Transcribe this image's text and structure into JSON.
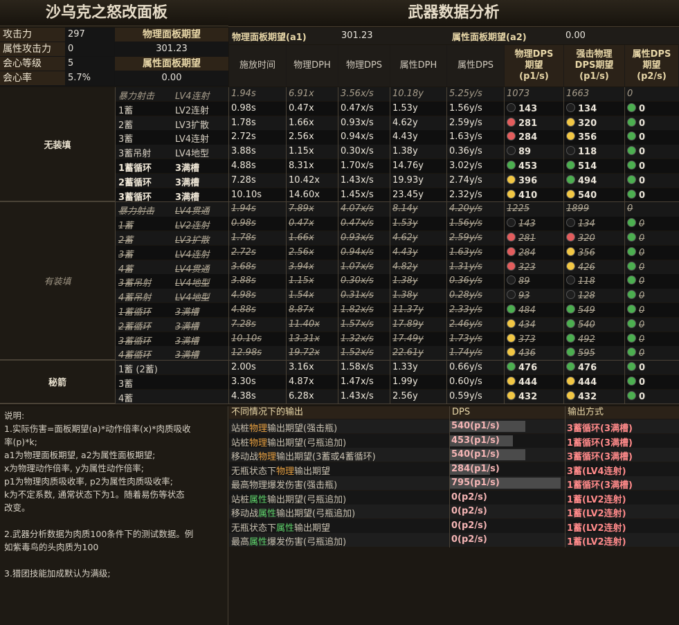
{
  "left_title": "沙乌克之怒改面板",
  "right_title": "武器数据分析",
  "stats": [
    {
      "label": "攻击力",
      "value": "297",
      "right": "物理面板期望"
    },
    {
      "label": "属性攻击力",
      "value": "0",
      "right": "301.23"
    },
    {
      "label": "会心等级",
      "value": "5",
      "right": "属性面板期望"
    },
    {
      "label": "会心率",
      "value": "5.7%",
      "right": "0.00"
    }
  ],
  "a1_label": "物理面板期望(a1)",
  "a1_value": "301.23",
  "a2_label": "属性面板期望(a2)",
  "a2_value": "0.00",
  "columns": [
    "施放时间",
    "物理DPH",
    "物理DPS",
    "属性DPH",
    "属性DPS",
    "物理DPS\n期望\n(p1/s)",
    "强击物理\nDPS期望\n(p1/s)",
    "属性DPS\n期望\n(p2/s)"
  ],
  "groups": [
    {
      "name": "无装填",
      "style": "normal",
      "rows": [
        {
          "a": "暴力射击",
          "b": "LV4连射",
          "v": [
            "1.94s",
            "6.91x",
            "3.56x/s",
            "10.18y",
            "5.25y/s",
            "1073",
            "1663",
            "0"
          ],
          "dots": [
            "",
            "",
            ""
          ],
          "style": "dim"
        },
        {
          "a": "1蓄",
          "b": "LV2连射",
          "v": [
            "0.98s",
            "0.47x",
            "0.47x/s",
            "1.53y",
            "1.56y/s",
            "143",
            "134",
            "0"
          ],
          "dots": [
            "#1e1e1e",
            "#1e1e1e",
            "#4caf50"
          ]
        },
        {
          "a": "2蓄",
          "b": "LV3扩散",
          "v": [
            "1.78s",
            "1.66x",
            "0.93x/s",
            "4.62y",
            "2.59y/s",
            "281",
            "320",
            "0"
          ],
          "dots": [
            "#e35d5d",
            "#f2c744",
            "#4caf50"
          ]
        },
        {
          "a": "3蓄",
          "b": "LV4连射",
          "v": [
            "2.72s",
            "2.56x",
            "0.94x/s",
            "4.43y",
            "1.63y/s",
            "284",
            "356",
            "0"
          ],
          "dots": [
            "#e35d5d",
            "#f2c744",
            "#4caf50"
          ]
        },
        {
          "a": "3蓄吊射",
          "b": "LV4地型",
          "v": [
            "3.88s",
            "1.15x",
            "0.30x/s",
            "1.38y",
            "0.36y/s",
            "89",
            "118",
            "0"
          ],
          "dots": [
            "#1e1e1e",
            "#1e1e1e",
            "#4caf50"
          ]
        },
        {
          "a": "1蓄循环",
          "b": "3满槽",
          "v": [
            "4.88s",
            "8.31x",
            "1.70x/s",
            "14.76y",
            "3.02y/s",
            "453",
            "514",
            "0"
          ],
          "dots": [
            "#4caf50",
            "#4caf50",
            "#4caf50"
          ],
          "style": "loop"
        },
        {
          "a": "2蓄循环",
          "b": "3满槽",
          "v": [
            "7.28s",
            "10.42x",
            "1.43x/s",
            "19.93y",
            "2.74y/s",
            "396",
            "494",
            "0"
          ],
          "dots": [
            "#f2c744",
            "#4caf50",
            "#4caf50"
          ],
          "style": "loop"
        },
        {
          "a": "3蓄循环",
          "b": "3满槽",
          "v": [
            "10.10s",
            "14.60x",
            "1.45x/s",
            "23.45y",
            "2.32y/s",
            "410",
            "540",
            "0"
          ],
          "dots": [
            "#f2c744",
            "#f2c744",
            "#4caf50"
          ],
          "style": "loop"
        }
      ]
    },
    {
      "name": "有装填",
      "style": "strike",
      "rows": [
        {
          "a": "暴力射击",
          "b": "LV4贯通",
          "v": [
            "1.94s",
            "7.89x",
            "4.07x/s",
            "8.14y",
            "4.20y/s",
            "1225",
            "1899",
            "0"
          ],
          "dots": [
            "",
            "",
            ""
          ]
        },
        {
          "a": "1蓄",
          "b": "LV2连射",
          "v": [
            "0.98s",
            "0.47x",
            "0.47x/s",
            "1.53y",
            "1.56y/s",
            "143",
            "134",
            "0"
          ],
          "dots": [
            "#1e1e1e",
            "#1e1e1e",
            "#4caf50"
          ]
        },
        {
          "a": "2蓄",
          "b": "LV3扩散",
          "v": [
            "1.78s",
            "1.66x",
            "0.93x/s",
            "4.62y",
            "2.59y/s",
            "281",
            "320",
            "0"
          ],
          "dots": [
            "#e35d5d",
            "#e35d5d",
            "#4caf50"
          ]
        },
        {
          "a": "3蓄",
          "b": "LV4连射",
          "v": [
            "2.72s",
            "2.56x",
            "0.94x/s",
            "4.43y",
            "1.63y/s",
            "284",
            "356",
            "0"
          ],
          "dots": [
            "#e35d5d",
            "#f2c744",
            "#4caf50"
          ]
        },
        {
          "a": "4蓄",
          "b": "LV4贯通",
          "v": [
            "3.68s",
            "3.94x",
            "1.07x/s",
            "4.82y",
            "1.31y/s",
            "323",
            "426",
            "0"
          ],
          "dots": [
            "#e35d5d",
            "#f2c744",
            "#4caf50"
          ]
        },
        {
          "a": "3蓄吊射",
          "b": "LV4地型",
          "v": [
            "3.88s",
            "1.15x",
            "0.30x/s",
            "1.38y",
            "0.36y/s",
            "89",
            "118",
            "0"
          ],
          "dots": [
            "#1e1e1e",
            "#1e1e1e",
            "#4caf50"
          ]
        },
        {
          "a": "4蓄吊射",
          "b": "LV4地型",
          "v": [
            "4.98s",
            "1.54x",
            "0.31x/s",
            "1.38y",
            "0.28y/s",
            "93",
            "128",
            "0"
          ],
          "dots": [
            "#1e1e1e",
            "#1e1e1e",
            "#4caf50"
          ]
        },
        {
          "a": "1蓄循环",
          "b": "3满槽",
          "v": [
            "4.88s",
            "8.87x",
            "1.82x/s",
            "11.37y",
            "2.33y/s",
            "484",
            "549",
            "0"
          ],
          "dots": [
            "#4caf50",
            "#4caf50",
            "#4caf50"
          ]
        },
        {
          "a": "2蓄循环",
          "b": "3满槽",
          "v": [
            "7.28s",
            "11.40x",
            "1.57x/s",
            "17.89y",
            "2.46y/s",
            "434",
            "540",
            "0"
          ],
          "dots": [
            "#f2c744",
            "#4caf50",
            "#4caf50"
          ]
        },
        {
          "a": "3蓄循环",
          "b": "3满槽",
          "v": [
            "10.10s",
            "13.31x",
            "1.32x/s",
            "17.49y",
            "1.73y/s",
            "373",
            "492",
            "0"
          ],
          "dots": [
            "#f2c744",
            "#4caf50",
            "#4caf50"
          ]
        },
        {
          "a": "4蓄循环",
          "b": "3满槽",
          "v": [
            "12.98s",
            "19.72x",
            "1.52x/s",
            "22.61y",
            "1.74y/s",
            "436",
            "595",
            "0"
          ],
          "dots": [
            "#f2c744",
            "#4caf50",
            "#4caf50"
          ]
        }
      ]
    },
    {
      "name": "秘箭",
      "style": "normal",
      "rows": [
        {
          "a": "1蓄 (2蓄)",
          "b": "",
          "v": [
            "2.00s",
            "3.16x",
            "1.58x/s",
            "1.33y",
            "0.66y/s",
            "476",
            "476",
            "0"
          ],
          "dots": [
            "#4caf50",
            "#4caf50",
            "#4caf50"
          ]
        },
        {
          "a": "3蓄",
          "b": "",
          "v": [
            "3.30s",
            "4.87x",
            "1.47x/s",
            "1.99y",
            "0.60y/s",
            "444",
            "444",
            "0"
          ],
          "dots": [
            "#f2c744",
            "#f2c744",
            "#4caf50"
          ]
        },
        {
          "a": "4蓄",
          "b": "",
          "v": [
            "4.38s",
            "6.28x",
            "1.43x/s",
            "2.56y",
            "0.59y/s",
            "432",
            "432",
            "0"
          ],
          "dots": [
            "#f2c744",
            "#f2c744",
            "#4caf50"
          ]
        }
      ]
    }
  ],
  "notes": [
    "说明:",
    "1.实际伤害=面板期望(a)*动作倍率(x)*肉质吸收",
    "率(p)*k;",
    "a1为物理面板期望, a2为属性面板期望;",
    "x为物理动作倍率, y为属性动作倍率;",
    "p1为物理肉质吸收率, p2为属性肉质吸收率;",
    "k为不定系数, 通常状态下为1。随着易伤等状态",
    "改变。",
    "",
    "2.武器分析数据为肉质100条件下的测试数据。例",
    "如紫毒鸟的头肉质为100",
    "",
    "3.猎团技能加成默认为满级;"
  ],
  "summary_headers": [
    "不同情况下的输出",
    "DPS",
    "输出方式"
  ],
  "summary": [
    {
      "pre": "站桩",
      "kw": "物理",
      "post": "输出期望(强击瓶)",
      "kwcolor": "orange",
      "dps": "540(p1/s)",
      "bar": 0.68,
      "mode": "3蓄循环(3满槽)",
      "modecolor": "pink"
    },
    {
      "pre": "站桩",
      "kw": "物理",
      "post": "输出期望(弓瓶追加)",
      "kwcolor": "orange",
      "dps": "453(p1/s)",
      "bar": 0.57,
      "mode": "1蓄循环(3满槽)",
      "modecolor": "pink"
    },
    {
      "pre": "移动战",
      "kw": "物理",
      "post": "输出期望(3蓄或4蓄循环)",
      "kwcolor": "orange",
      "dps": "540(p1/s)",
      "bar": 0.68,
      "mode": "3蓄循环(3满槽)",
      "modecolor": "pink"
    },
    {
      "pre": "无瓶状态下",
      "kw": "物理",
      "post": "输出期望",
      "kwcolor": "orange",
      "dps": "284(p1/s)",
      "bar": 0.36,
      "mode": "3蓄(LV4连射)",
      "modecolor": "pink"
    },
    {
      "pre": "最高物理爆发伤害(强击瓶)",
      "kw": "",
      "post": "",
      "kwcolor": "orange",
      "dps": "795(p1/s)",
      "bar": 1.0,
      "mode": "1蓄循环(3满槽)",
      "modecolor": "pink"
    },
    {
      "pre": "站桩",
      "kw": "属性",
      "post": "输出期望(弓瓶追加)",
      "kwcolor": "green",
      "dps": "0(p2/s)",
      "bar": 0,
      "mode": "1蓄(LV2连射)",
      "modecolor": "pink"
    },
    {
      "pre": "移动战",
      "kw": "属性",
      "post": "输出期望(弓瓶追加)",
      "kwcolor": "green",
      "dps": "0(p2/s)",
      "bar": 0,
      "mode": "1蓄(LV2连射)",
      "modecolor": "pink"
    },
    {
      "pre": "无瓶状态下",
      "kw": "属性",
      "post": "输出期望",
      "kwcolor": "green",
      "dps": "0(p2/s)",
      "bar": 0,
      "mode": "1蓄(LV2连射)",
      "modecolor": "pink"
    },
    {
      "pre": "最高",
      "kw": "属性",
      "post": "爆发伤害(弓瓶追加)",
      "kwcolor": "green",
      "dps": "0(p2/s)",
      "bar": 0,
      "mode": "1蓄(LV2连射)",
      "modecolor": "pink"
    }
  ]
}
